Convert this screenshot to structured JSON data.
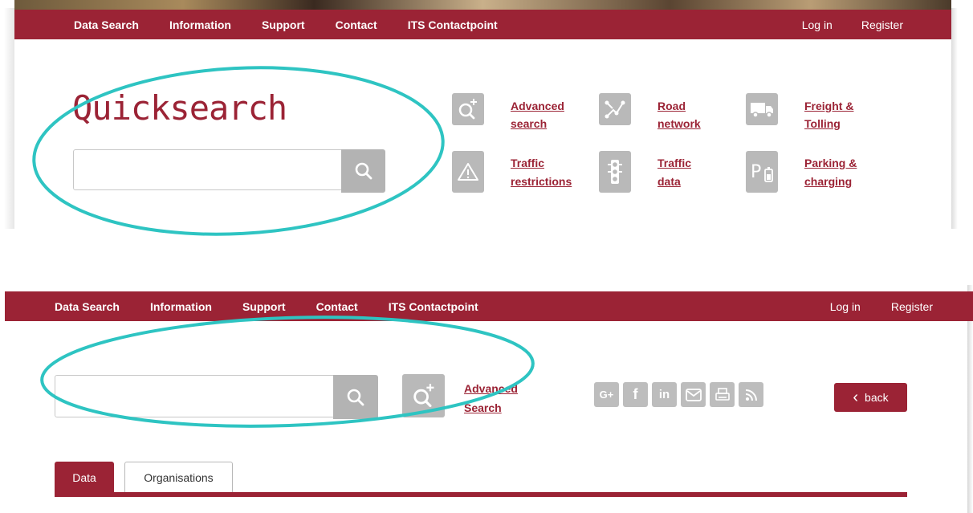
{
  "colors": {
    "brand": "#9b2335",
    "tile_gray": "#b9b9b9",
    "highlight": "#2ec4c2"
  },
  "top": {
    "nav": {
      "left_items": [
        "Data Search",
        "Information",
        "Support",
        "Contact",
        "ITS Contactpoint"
      ],
      "login": "Log in",
      "register": "Register"
    },
    "quicksearch_title": "Quicksearch",
    "search": {
      "value": "",
      "placeholder": "",
      "icon": "search-icon"
    },
    "tiles": [
      {
        "icon": "advanced-search-icon",
        "line1": "Advanced",
        "line2": "search"
      },
      {
        "icon": "road-network-icon",
        "line1": "Road",
        "line2": "network"
      },
      {
        "icon": "truck-icon",
        "line1": "Freight &",
        "line2": "Tolling"
      },
      {
        "icon": "warning-icon",
        "line1": "Traffic",
        "line2": "restrictions"
      },
      {
        "icon": "traffic-light-icon",
        "line1": "Traffic",
        "line2": "data"
      },
      {
        "icon": "parking-charging-icon",
        "line1": "Parking &",
        "line2": "charging"
      }
    ]
  },
  "bottom": {
    "nav": {
      "left_items": [
        "Data Search",
        "Information",
        "Support",
        "Contact",
        "ITS Contactpoint"
      ],
      "login": "Log in",
      "register": "Register"
    },
    "search": {
      "value": "",
      "placeholder": "",
      "icon": "search-icon"
    },
    "advanced_search": {
      "icon": "advanced-search-icon",
      "line1": "Advanced",
      "line2": "Search"
    },
    "social": [
      {
        "icon": "google-plus-icon",
        "glyph": "G+"
      },
      {
        "icon": "facebook-icon",
        "glyph": "f"
      },
      {
        "icon": "linkedin-icon",
        "glyph": "in"
      },
      {
        "icon": "mail-icon",
        "glyph": ""
      },
      {
        "icon": "print-icon",
        "glyph": ""
      },
      {
        "icon": "rss-icon",
        "glyph": ""
      }
    ],
    "back_button": {
      "icon": "chevron-left-icon",
      "glyph": "‹",
      "label": "back"
    },
    "tabs": [
      {
        "label": "Data",
        "active": true
      },
      {
        "label": "Organisations",
        "active": false
      }
    ]
  }
}
